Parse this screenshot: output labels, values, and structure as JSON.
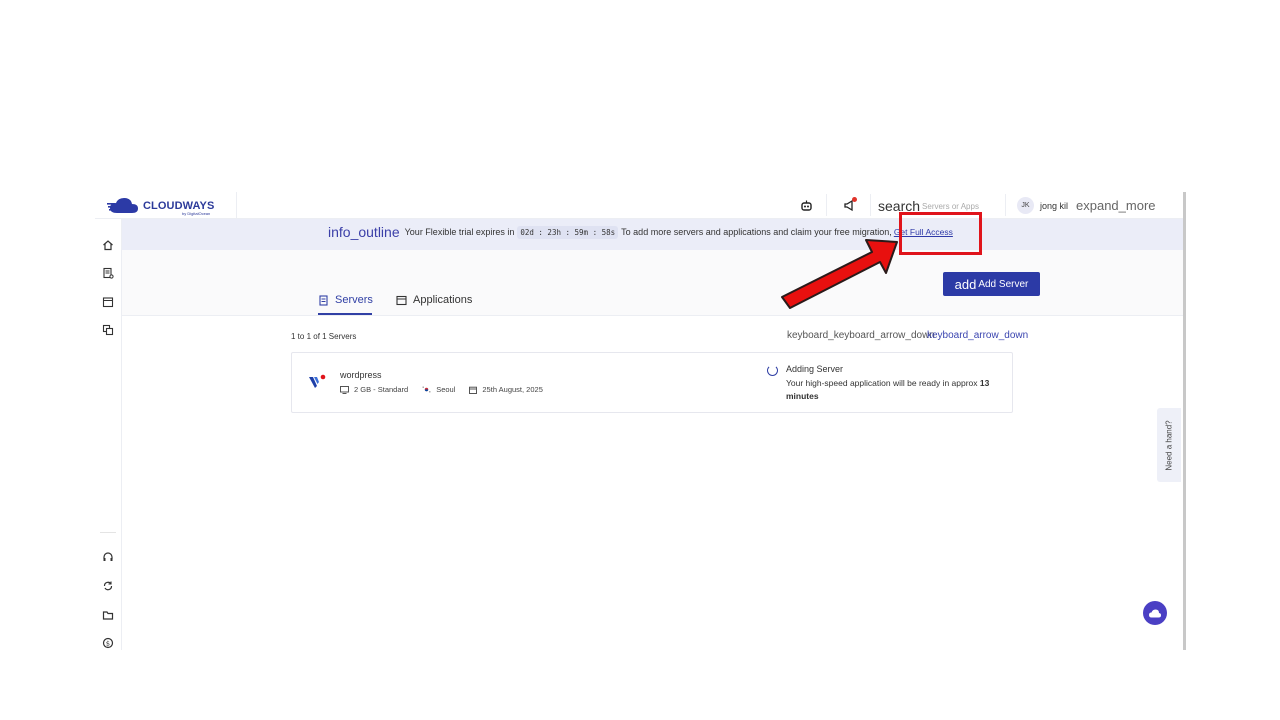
{
  "brand": {
    "name": "CLOUDWAYS",
    "sub": "by DigitalOcean",
    "accent": "#2c3aa6"
  },
  "topbar": {
    "search_icon": "search",
    "search_placeholder": "Servers or Apps",
    "user_initials": "JK",
    "user_name": "jong kil",
    "expand_icon": "expand_more"
  },
  "banner": {
    "icon": "info_outline",
    "text_before": "Your Flexible trial expires in",
    "timer": "02d : 23h : 59m : 58s",
    "text_after": "To add more servers and applications and claim your free migration,",
    "link": "Get Full Access"
  },
  "tabs": [
    {
      "label": "Servers",
      "active": true
    },
    {
      "label": "Applications",
      "active": false
    }
  ],
  "add_server": {
    "icon": "add",
    "label": "Add Server"
  },
  "list": {
    "count": "1 to 1 of 1 Servers",
    "sort_overlap_a": "keyboard_keyboard_arrow_down",
    "sort_overlap_b": "keyboard_arrow_down"
  },
  "servers": [
    {
      "name": "wordpress",
      "size": "2 GB - Standard",
      "location": "Seoul",
      "date": "25th August, 2025",
      "status_title": "Adding Server",
      "status_desc": "Your high-speed application will be ready in approx",
      "status_eta": "13 minutes"
    }
  ],
  "help_tab": "Need a hand?",
  "annotation": {
    "color": "#e0141b"
  }
}
